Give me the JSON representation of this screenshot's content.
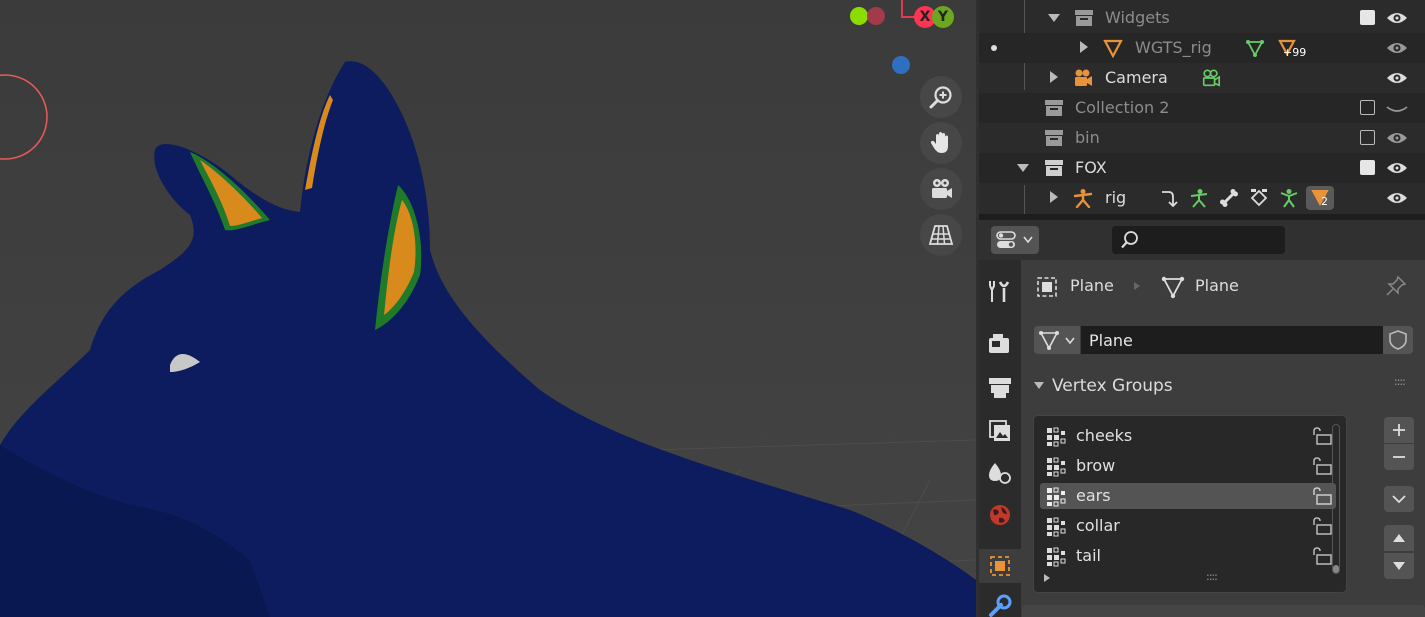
{
  "viewport": {
    "gizmo": {
      "x_label": "X",
      "y_label": "Y"
    },
    "nav_buttons": [
      "zoom-icon",
      "pan-hand-icon",
      "camera-view-icon",
      "perspective-grid-icon"
    ]
  },
  "outliner": {
    "rows": [
      {
        "name": "Widgets",
        "dim": true
      },
      {
        "name": "WGTS_rig",
        "dim": true,
        "badge": "+99"
      },
      {
        "name": "Camera",
        "dim": false
      },
      {
        "name": "Collection 2",
        "dim": true
      },
      {
        "name": "bin",
        "dim": true
      },
      {
        "name": "FOX",
        "dim": false
      },
      {
        "name": "rig",
        "dim": false,
        "badge": "2"
      }
    ]
  },
  "properties": {
    "search_placeholder": "",
    "breadcrumb": {
      "object": "Plane",
      "data": "Plane"
    },
    "mesh_name": "Plane",
    "panel_title": "Vertex Groups",
    "vertex_groups": [
      "cheeks",
      "brow",
      "ears",
      "collar",
      "tail"
    ],
    "selected_group": "ears",
    "list_grip": "::::",
    "panel_grip": "::::"
  },
  "colors": {
    "accent_orange": "#e8923a",
    "gizmo_x": "#ff3352",
    "gizmo_y": "#8bdc00",
    "gizmo_z": "#2f83e8",
    "data_green": "#66cc66"
  }
}
